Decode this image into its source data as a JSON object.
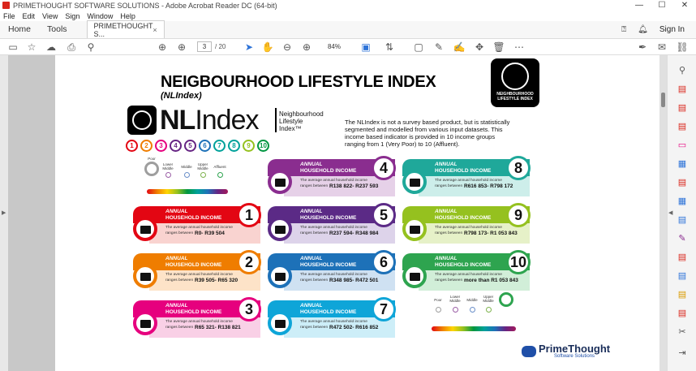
{
  "window": {
    "title": "PRIMETHOUGHT SOFTWARE SOLUTIONS - Adobe Acrobat Reader DC (64-bit)",
    "min": "—",
    "max": "☐",
    "close": "✕"
  },
  "menu": [
    "File",
    "Edit",
    "View",
    "Sign",
    "Window",
    "Help"
  ],
  "tabs": {
    "home": "Home",
    "tools": "Tools",
    "doc": "PRIMETHOUGHT S...",
    "close": "×",
    "signin": "Sign In"
  },
  "toolbar": {
    "page_current": "3",
    "page_total": "/ 20",
    "zoom": "84%"
  },
  "document": {
    "title": "NEIGBOURHOOD LIFESTYLE INDEX",
    "subtitle": "(NLIndex)",
    "logo_text": "NEIGHBOURHOOD LIFESTYLE INDEX",
    "nl_left": "NL",
    "nl_right": "Index",
    "nl_small_1": "Neighbourhood",
    "nl_small_2": "Lifestyle",
    "nl_small_3": "Index™",
    "description": "The NLIndex is not a survey based product, but is statistically segmented and modelled from various input datasets. This income based indicator is provided in 10 income groups ranging from 1 (Very Poor) to 10 (Affluent).",
    "numbers": [
      "1",
      "2",
      "3",
      "4",
      "5",
      "6",
      "7",
      "8",
      "9",
      "10"
    ],
    "number_colors": [
      "#e30613",
      "#ef7d00",
      "#e6007e",
      "#662483",
      "#662483",
      "#1d71b8",
      "#00a19a",
      "#00a19a",
      "#95c11f",
      "#009640"
    ],
    "legend_labels": {
      "poor": "Poor",
      "lower_middle": "Lower Middle",
      "middle": "Middle",
      "upper_middle": "Upper Middle",
      "affluent": "Affluent"
    },
    "card_heading_1": "ANNUAL",
    "card_heading_2": "HOUSEHOLD INCOME",
    "card_desc_1": "The average annual household income",
    "card_desc_2": "ranges between",
    "cards": [
      {
        "num": "1",
        "range": "R0- R39 504",
        "color": "#e30613",
        "light": "#f9d3d0"
      },
      {
        "num": "2",
        "range": "R39 505- R65 320",
        "color": "#ef7d00",
        "light": "#fde3c8"
      },
      {
        "num": "3",
        "range": "R65 321- R138 821",
        "color": "#e6007e",
        "light": "#f9d0e6"
      },
      {
        "num": "4",
        "range": "R138 822- R237 593",
        "color": "#8a2d8f",
        "light": "#e6d1e8"
      },
      {
        "num": "5",
        "range": "R237 594- R348 984",
        "color": "#5b2a86",
        "light": "#ddd3ea"
      },
      {
        "num": "6",
        "range": "R348 985- R472 501",
        "color": "#1d71b8",
        "light": "#cfe1f2"
      },
      {
        "num": "7",
        "range": "R472 502- R616 852",
        "color": "#0ea5d8",
        "light": "#cdeef8"
      },
      {
        "num": "8",
        "range": "R616 853- R798 172",
        "color": "#1fa89a",
        "light": "#cdeeea"
      },
      {
        "num": "9",
        "range": "R798 173- R1 053 843",
        "color": "#95c11f",
        "light": "#e6f1c8"
      },
      {
        "num": "10",
        "range": "more than R1 053 843",
        "color": "#2ea44f",
        "light": "#d1eed8"
      }
    ],
    "brand_name": "PrimeThought",
    "brand_sub": "Software Solutions"
  },
  "colors": {
    "accent": "#2d73d8",
    "red": "#d9261c"
  }
}
